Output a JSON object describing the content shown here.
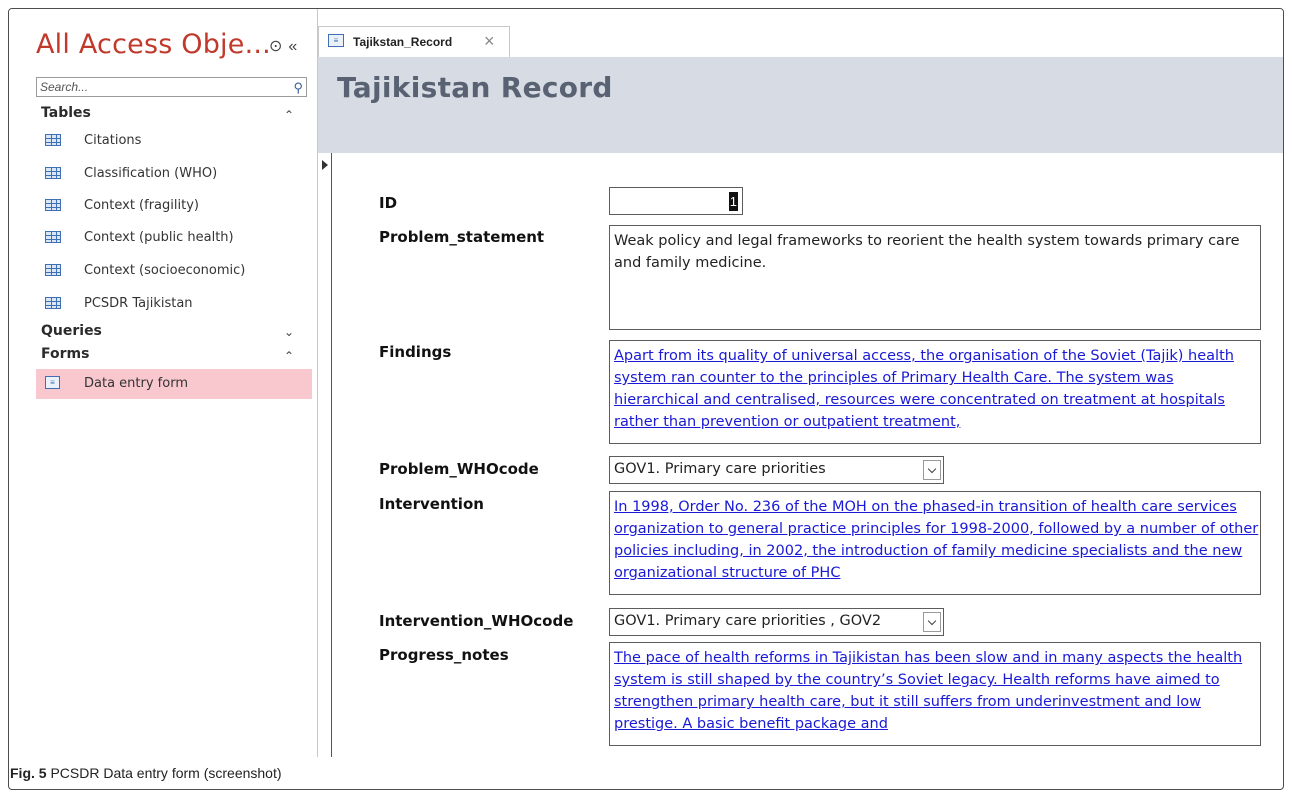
{
  "nav": {
    "title": "All Access Obje...",
    "title_controls": [
      "⊙",
      "«"
    ],
    "search_placeholder": "Search...",
    "groups": {
      "tables": "Tables",
      "queries": "Queries",
      "forms": "Forms"
    },
    "tables": [
      "Citations",
      "Classification (WHO)",
      "Context (fragility)",
      "Context (public health)",
      "Context (socioeconomic)",
      "PCSDR Tajikistan"
    ],
    "forms": [
      "Data entry form"
    ]
  },
  "tab": {
    "label": "Tajikstan_Record",
    "close": "×"
  },
  "form": {
    "title": "Tajikistan Record",
    "fields": {
      "id_label": "ID",
      "id_value": "1",
      "problem_statement_label": "Problem_statement",
      "problem_statement_value": " Weak policy and legal frameworks to reorient the health system towards primary care and family medicine.",
      "findings_label": "Findings",
      "findings_value": "Apart from its quality of universal access, the organisation of the Soviet (Tajik) health system ran counter to the principles of Primary Health Care. The system was hierarchical and centralised, resources were concentrated on treatment at hospitals rather than prevention or outpatient treatment,",
      "problem_whocode_label": "Problem_WHOcode",
      "problem_whocode_value": "GOV1. Primary care priorities",
      "intervention_label": "Intervention",
      "intervention_value": "In 1998, Order No. 236 of the MOH on the phased-in transition of health care services organization to general practice principles for 1998-2000, followed by a number of other policies including, in 2002, the introduction of family medicine specialists and the new organizational structure of PHC",
      "intervention_whocode_label": "Intervention_WHOcode",
      "intervention_whocode_value": "GOV1. Primary care priorities , GOV2",
      "progress_notes_label": "Progress_notes",
      "progress_notes_value": "The pace of health reforms in Tajikistan has been slow and in many aspects the health system is still shaped by the country’s Soviet legacy. Health reforms have aimed to strengthen primary health care, but it still suffers from underinvestment and low prestige. A basic benefit package and"
    }
  },
  "caption": {
    "prefix": "Fig. 5",
    "text": " PCSDR Data entry form (screenshot)"
  },
  "colors": {
    "nav_title": "#c0392b",
    "selected_item": "#f9c8cf",
    "header_band": "#d6dbe4",
    "hyperlink_text": "#1a1ad6"
  }
}
